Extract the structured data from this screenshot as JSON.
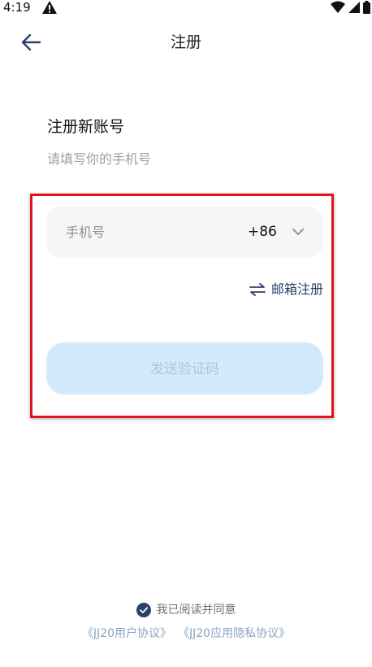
{
  "status_bar": {
    "time": "4:19",
    "icons": [
      "alert-icon",
      "wifi-icon",
      "signal-icon",
      "battery-icon"
    ]
  },
  "header": {
    "back_icon": "arrow-left-icon",
    "title": "注册"
  },
  "intro": {
    "heading": "注册新账号",
    "subheading": "请填写你的手机号"
  },
  "phone": {
    "placeholder": "手机号",
    "value": "",
    "country_code": "+86",
    "dropdown_icon": "chevron-down-icon"
  },
  "email_switch": {
    "icon": "swap-arrows-icon",
    "label": "邮箱注册"
  },
  "send_button": {
    "label": "发送验证码"
  },
  "agreement": {
    "checked": true,
    "text": "我已阅读并同意",
    "user_agreement": "《JJ20用户协议》",
    "privacy_policy": "《JJ20应用隐私协议》"
  },
  "colors": {
    "accent": "#2c3e6b",
    "button_disabled_bg": "#d3e9fc",
    "button_disabled_text": "#a9c8e2",
    "highlight": "#e0141a",
    "link_muted": "#8ea2c2"
  }
}
